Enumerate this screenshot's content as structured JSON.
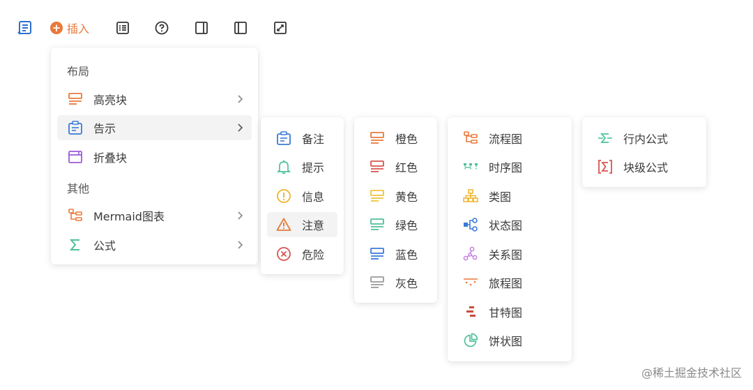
{
  "toolbar": {
    "outline_icon": "list-outline-icon",
    "insert_label": "插入",
    "items": [
      "table-of-contents-icon",
      "help-circle-icon",
      "right-sidebar-icon",
      "left-sidebar-icon",
      "fullscreen-icon"
    ]
  },
  "main_menu": {
    "sections": [
      {
        "title": "布局",
        "items": [
          {
            "label": "高亮块",
            "icon": "highlight-block-icon",
            "has_submenu": true
          },
          {
            "label": "告示",
            "icon": "notice-icon",
            "has_submenu": true,
            "active": true
          },
          {
            "label": "折叠块",
            "icon": "collapse-block-icon",
            "has_submenu": false
          }
        ]
      },
      {
        "title": "其他",
        "items": [
          {
            "label": "Mermaid图表",
            "icon": "mermaid-chart-icon",
            "has_submenu": true
          },
          {
            "label": "公式",
            "icon": "sigma-icon",
            "has_submenu": true
          }
        ]
      }
    ]
  },
  "notice_menu": {
    "items": [
      {
        "label": "备注",
        "icon": "note-icon"
      },
      {
        "label": "提示",
        "icon": "bell-icon"
      },
      {
        "label": "信息",
        "icon": "info-icon"
      },
      {
        "label": "注意",
        "icon": "warning-icon",
        "active": true
      },
      {
        "label": "危险",
        "icon": "danger-icon"
      }
    ]
  },
  "color_menu": {
    "items": [
      {
        "label": "橙色",
        "color": "#e8793a"
      },
      {
        "label": "红色",
        "color": "#d9534f"
      },
      {
        "label": "黄色",
        "color": "#f0c23b"
      },
      {
        "label": "绿色",
        "color": "#4fc19a"
      },
      {
        "label": "蓝色",
        "color": "#3a7bd5"
      },
      {
        "label": "灰色",
        "color": "#9a9a9a"
      }
    ]
  },
  "mermaid_menu": {
    "items": [
      {
        "label": "流程图",
        "icon": "flowchart-icon"
      },
      {
        "label": "时序图",
        "icon": "sequence-icon"
      },
      {
        "label": "类图",
        "icon": "class-diagram-icon"
      },
      {
        "label": "状态图",
        "icon": "state-diagram-icon"
      },
      {
        "label": "关系图",
        "icon": "relation-diagram-icon"
      },
      {
        "label": "旅程图",
        "icon": "journey-icon"
      },
      {
        "label": "甘特图",
        "icon": "gantt-icon"
      },
      {
        "label": "饼状图",
        "icon": "pie-icon"
      }
    ]
  },
  "formula_menu": {
    "items": [
      {
        "label": "行内公式",
        "icon": "inline-formula-icon"
      },
      {
        "label": "块级公式",
        "icon": "block-formula-icon"
      }
    ]
  },
  "watermark": "@稀土掘金技术社区"
}
